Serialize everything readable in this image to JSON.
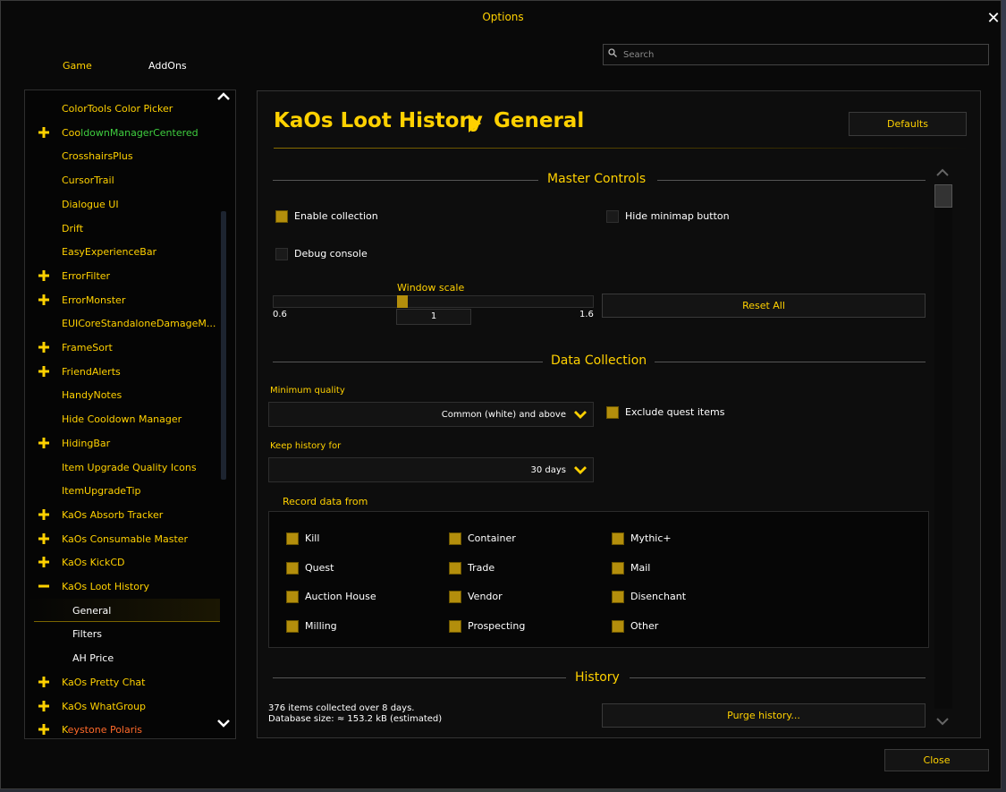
{
  "window": {
    "title": "Options",
    "close_label": "Close"
  },
  "tabs": [
    {
      "label": "Game"
    },
    {
      "label": "AddOns"
    }
  ],
  "search": {
    "placeholder": "Search"
  },
  "sidebar": {
    "items": [
      {
        "label": "ColorTools Color Picker",
        "expander": "none",
        "color": "#ffd100"
      },
      {
        "label_a": "Coo",
        "label_b": "ldownManagerCentered",
        "expander": "plus",
        "color_a": "#ffd100",
        "color_b": "#3fce3f"
      },
      {
        "label": "CrosshairsPlus",
        "expander": "none",
        "color": "#ffd100"
      },
      {
        "label": "CursorTrail",
        "expander": "none",
        "color": "#ffd100"
      },
      {
        "label": "Dialogue UI",
        "expander": "none",
        "color": "#ffd100"
      },
      {
        "label": "Drift",
        "expander": "none",
        "color": "#ffd100"
      },
      {
        "label": "EasyExperienceBar",
        "expander": "none",
        "color": "#ffd100"
      },
      {
        "label": "ErrorFilter",
        "expander": "plus",
        "color": "#ffd100"
      },
      {
        "label": "ErrorMonster",
        "expander": "plus",
        "color": "#ffd100"
      },
      {
        "label": "EUICoreStandaloneDamageM...",
        "expander": "none",
        "color": "#ffd100"
      },
      {
        "label": "FrameSort",
        "expander": "plus",
        "color": "#ffd100"
      },
      {
        "label": "FriendAlerts",
        "expander": "plus",
        "color": "#ffd100"
      },
      {
        "label": "HandyNotes",
        "expander": "none",
        "color": "#ffd100"
      },
      {
        "label": "Hide Cooldown Manager",
        "expander": "none",
        "color": "#ffd100"
      },
      {
        "label": "HidingBar",
        "expander": "plus",
        "color": "#ffd100"
      },
      {
        "label": "Item Upgrade Quality Icons",
        "expander": "none",
        "color": "#ffd100"
      },
      {
        "label": "ItemUpgradeTip",
        "expander": "none",
        "color": "#ffd100"
      },
      {
        "label": "KaOs Absorb Tracker",
        "expander": "plus",
        "color": "#ffd100"
      },
      {
        "label": "KaOs Consumable Master",
        "expander": "plus",
        "color": "#ffd100"
      },
      {
        "label": "KaOs KickCD",
        "expander": "plus",
        "color": "#ffd100"
      },
      {
        "label": "KaOs Loot History",
        "expander": "minus",
        "color": "#ffd100"
      },
      {
        "label": "General",
        "sub": true,
        "selected": true
      },
      {
        "label": "Filters",
        "sub": true
      },
      {
        "label": "AH Price",
        "sub": true
      },
      {
        "label": "KaOs Pretty Chat",
        "expander": "plus",
        "color": "#ffd100"
      },
      {
        "label": "KaOs WhatGroup",
        "expander": "plus",
        "color": "#ffd100"
      },
      {
        "label_a": "K",
        "label_b": "eystone Polaris",
        "expander": "plus",
        "color_a": "#ffd100",
        "color_b": "#ff6a2a"
      }
    ]
  },
  "panel": {
    "breadcrumb_addon": "KaOs Loot History",
    "breadcrumb_page": "General",
    "defaults_label": "Defaults",
    "master_controls": {
      "title": "Master Controls",
      "enable_collection": {
        "label": "Enable collection",
        "checked": true
      },
      "hide_minimap": {
        "label": "Hide minimap button",
        "checked": false
      },
      "debug_console": {
        "label": "Debug console",
        "checked": false
      },
      "window_scale": {
        "label": "Window scale",
        "min": "0.6",
        "max": "1.6",
        "value": "1"
      },
      "reset_all_label": "Reset All"
    },
    "data_collection": {
      "title": "Data Collection",
      "min_quality_label": "Minimum quality",
      "min_quality_value": "Common (white) and above",
      "exclude_quest": {
        "label": "Exclude quest items",
        "checked": true
      },
      "keep_history_label": "Keep history for",
      "keep_history_value": "30 days",
      "record_from_label": "Record data from",
      "sources": [
        {
          "label": "Kill",
          "checked": true
        },
        {
          "label": "Container",
          "checked": true
        },
        {
          "label": "Mythic+",
          "checked": true
        },
        {
          "label": "Quest",
          "checked": true
        },
        {
          "label": "Trade",
          "checked": true
        },
        {
          "label": "Mail",
          "checked": true
        },
        {
          "label": "Auction House",
          "checked": true
        },
        {
          "label": "Vendor",
          "checked": true
        },
        {
          "label": "Disenchant",
          "checked": true
        },
        {
          "label": "Milling",
          "checked": true
        },
        {
          "label": "Prospecting",
          "checked": true
        },
        {
          "label": "Other",
          "checked": true
        }
      ]
    },
    "history": {
      "title": "History",
      "summary": "376 items collected over 8 days.",
      "db_size": "Database size: ≈ 153.2 kB  (estimated)",
      "purge_label": "Purge history..."
    }
  },
  "colors": {
    "accent": "#ffd100",
    "checkbox_on": "#b38e0c",
    "panel_bg": "#0d0d0d"
  }
}
